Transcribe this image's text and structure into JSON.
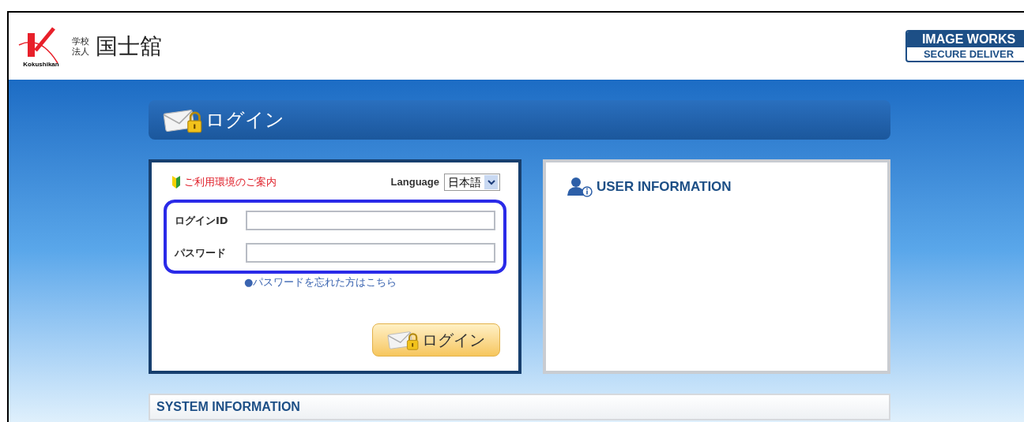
{
  "header": {
    "logo": {
      "mark_caption": "Kokushikan",
      "small_top": "学校",
      "small_bottom": "法人",
      "name": "国士舘"
    },
    "brand": {
      "top": "IMAGE WORKS",
      "bottom": "SECURE DELIVER"
    }
  },
  "login_bar": {
    "title": "ログイン"
  },
  "login_panel": {
    "guide_link": "ご利用環境のご案内",
    "language_label": "Language",
    "language_value": "日本語",
    "fields": [
      {
        "label": "ログインID"
      },
      {
        "label": "パスワード"
      }
    ],
    "highlighted": true,
    "forgot_link": "●パスワードを忘れた方はこちら",
    "login_button": "ログイン"
  },
  "user_info": {
    "title": "USER INFORMATION"
  },
  "system_info": {
    "title": "SYSTEM INFORMATION"
  }
}
